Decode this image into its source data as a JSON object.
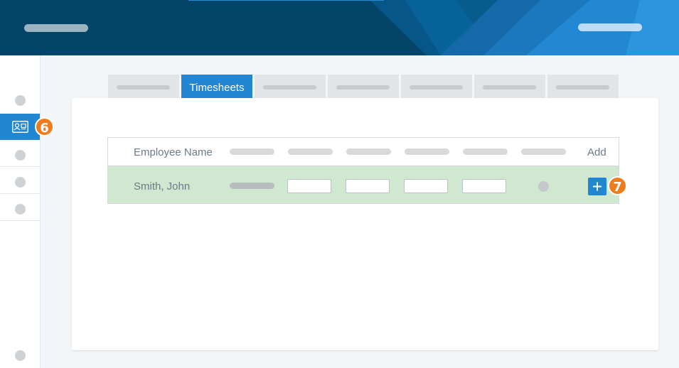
{
  "app": {
    "brand_color": "#034468",
    "accent_color": "#2286d2",
    "callout_color": "#f07b1d"
  },
  "tabs": {
    "active_label": "Timesheets"
  },
  "table": {
    "header": {
      "employee_col": "Employee Name",
      "add_col": "Add"
    },
    "rows": [
      {
        "name": "Smith, John",
        "highlight_color": "#cfe8cf"
      }
    ]
  },
  "callouts": {
    "sidebar": "6",
    "add_button": "7"
  },
  "icons": {
    "sidebar_active": "employee-card-icon",
    "add": "plus-icon"
  }
}
